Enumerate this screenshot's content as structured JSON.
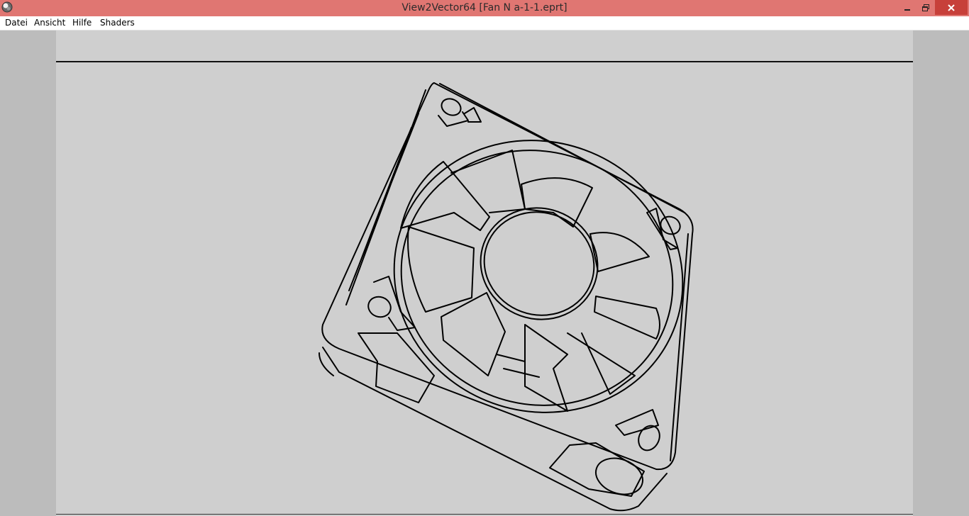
{
  "window": {
    "title": "View2Vector64 [Fan N a-1-1.eprt]",
    "icon": "app-globe-icon",
    "controls": {
      "minimize": "minimize-icon",
      "restore": "restore-icon",
      "close": "close-icon"
    },
    "colors": {
      "titlebar": "#e07672",
      "close_button": "#c7403a"
    }
  },
  "menu": {
    "items": [
      {
        "label": "Datei"
      },
      {
        "label": "Ansicht"
      },
      {
        "label": "Hilfe"
      },
      {
        "label": "Shaders"
      }
    ]
  },
  "viewport": {
    "model_icon": "fan-wireframe-drawing",
    "colors": {
      "background": "#cfcfcf",
      "outside": "#bcbcbc",
      "stroke": "#000000"
    }
  }
}
